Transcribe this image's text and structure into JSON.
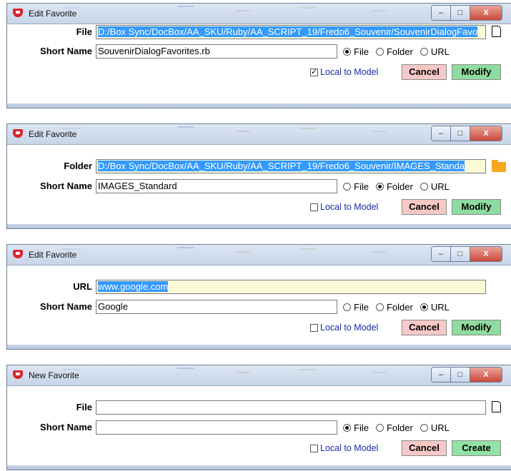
{
  "dialogs": [
    {
      "title": "Edit Favorite",
      "path_label": "File",
      "path_value": "D:/Box Sync/DocBox/AA_SKU/Ruby/AA_SCRIPT_19/Fredo6_Souvenir/SouvenirDialogFavo",
      "path_icon": "file-icon",
      "short_name_label": "Short Name",
      "short_name_value": "SouvenirDialogFavorites.rb",
      "radios": {
        "file": "File",
        "folder": "Folder",
        "url": "URL"
      },
      "selected_type": "File",
      "local_label": "Local to Model",
      "local_checked": true,
      "cancel_label": "Cancel",
      "action_label": "Modify"
    },
    {
      "title": "Edit Favorite",
      "path_label": "Folder",
      "path_value": "D:/Box Sync/DocBox/AA_SKU/Ruby/AA_SCRIPT_19/Fredo6_Souvenir/IMAGES_Standa",
      "path_icon": "folder-icon",
      "short_name_label": "Short Name",
      "short_name_value": "IMAGES_Standard",
      "radios": {
        "file": "File",
        "folder": "Folder",
        "url": "URL"
      },
      "selected_type": "Folder",
      "local_label": "Local to Model",
      "local_checked": false,
      "cancel_label": "Cancel",
      "action_label": "Modify"
    },
    {
      "title": "Edit Favorite",
      "path_label": "URL",
      "path_value": "www.google.com",
      "path_icon": "",
      "short_name_label": "Short Name",
      "short_name_value": "Google",
      "radios": {
        "file": "File",
        "folder": "Folder",
        "url": "URL"
      },
      "selected_type": "URL",
      "local_label": "Local to Model",
      "local_checked": false,
      "cancel_label": "Cancel",
      "action_label": "Modify"
    },
    {
      "title": "New Favorite",
      "path_label": "File",
      "path_value": "",
      "path_icon": "file-icon",
      "short_name_label": "Short Name",
      "short_name_value": "",
      "radios": {
        "file": "File",
        "folder": "Folder",
        "url": "URL"
      },
      "selected_type": "File",
      "local_label": "Local to Model",
      "local_checked": false,
      "cancel_label": "Cancel",
      "action_label": "Create"
    }
  ],
  "window_buttons": {
    "minimize": "–",
    "maximize": "□",
    "close": "X"
  }
}
